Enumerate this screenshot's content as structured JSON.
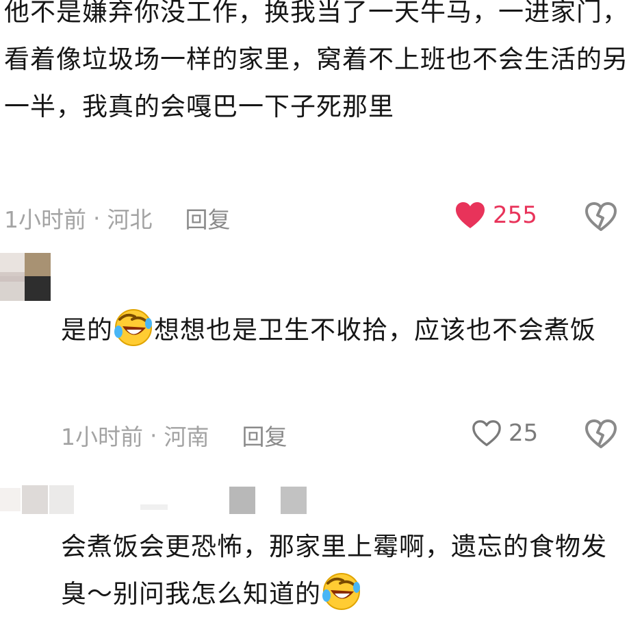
{
  "comments": [
    {
      "text_before": "他不是嫌弃你没工作，换我当了一天牛马，一进家门，看着像垃圾场一样的家里，窝着不上班也不会生活的另一半，我真的会嘎巴一下子死那里",
      "time": "1小时前",
      "location": "河北",
      "reply_label": "回复",
      "likes": "255",
      "liked": true
    },
    {
      "text_before": "是的",
      "text_after": "想想也是卫生不收拾，应该也不会煮饭",
      "emoji_icon": "rolling-laughing-emoji",
      "time": "1小时前",
      "location": "河南",
      "reply_label": "回复",
      "likes": "25",
      "liked": false
    },
    {
      "text_before": "会煮饭会更恐怖，那家里上霉啊，遗忘的食物发臭～别问我怎么知道的",
      "emoji_icon": "rolling-laughing-emoji"
    }
  ],
  "separator": "·",
  "colors": {
    "like_active": "#e8335a",
    "meta_gray": "#a3a3a3",
    "text": "#161616"
  }
}
